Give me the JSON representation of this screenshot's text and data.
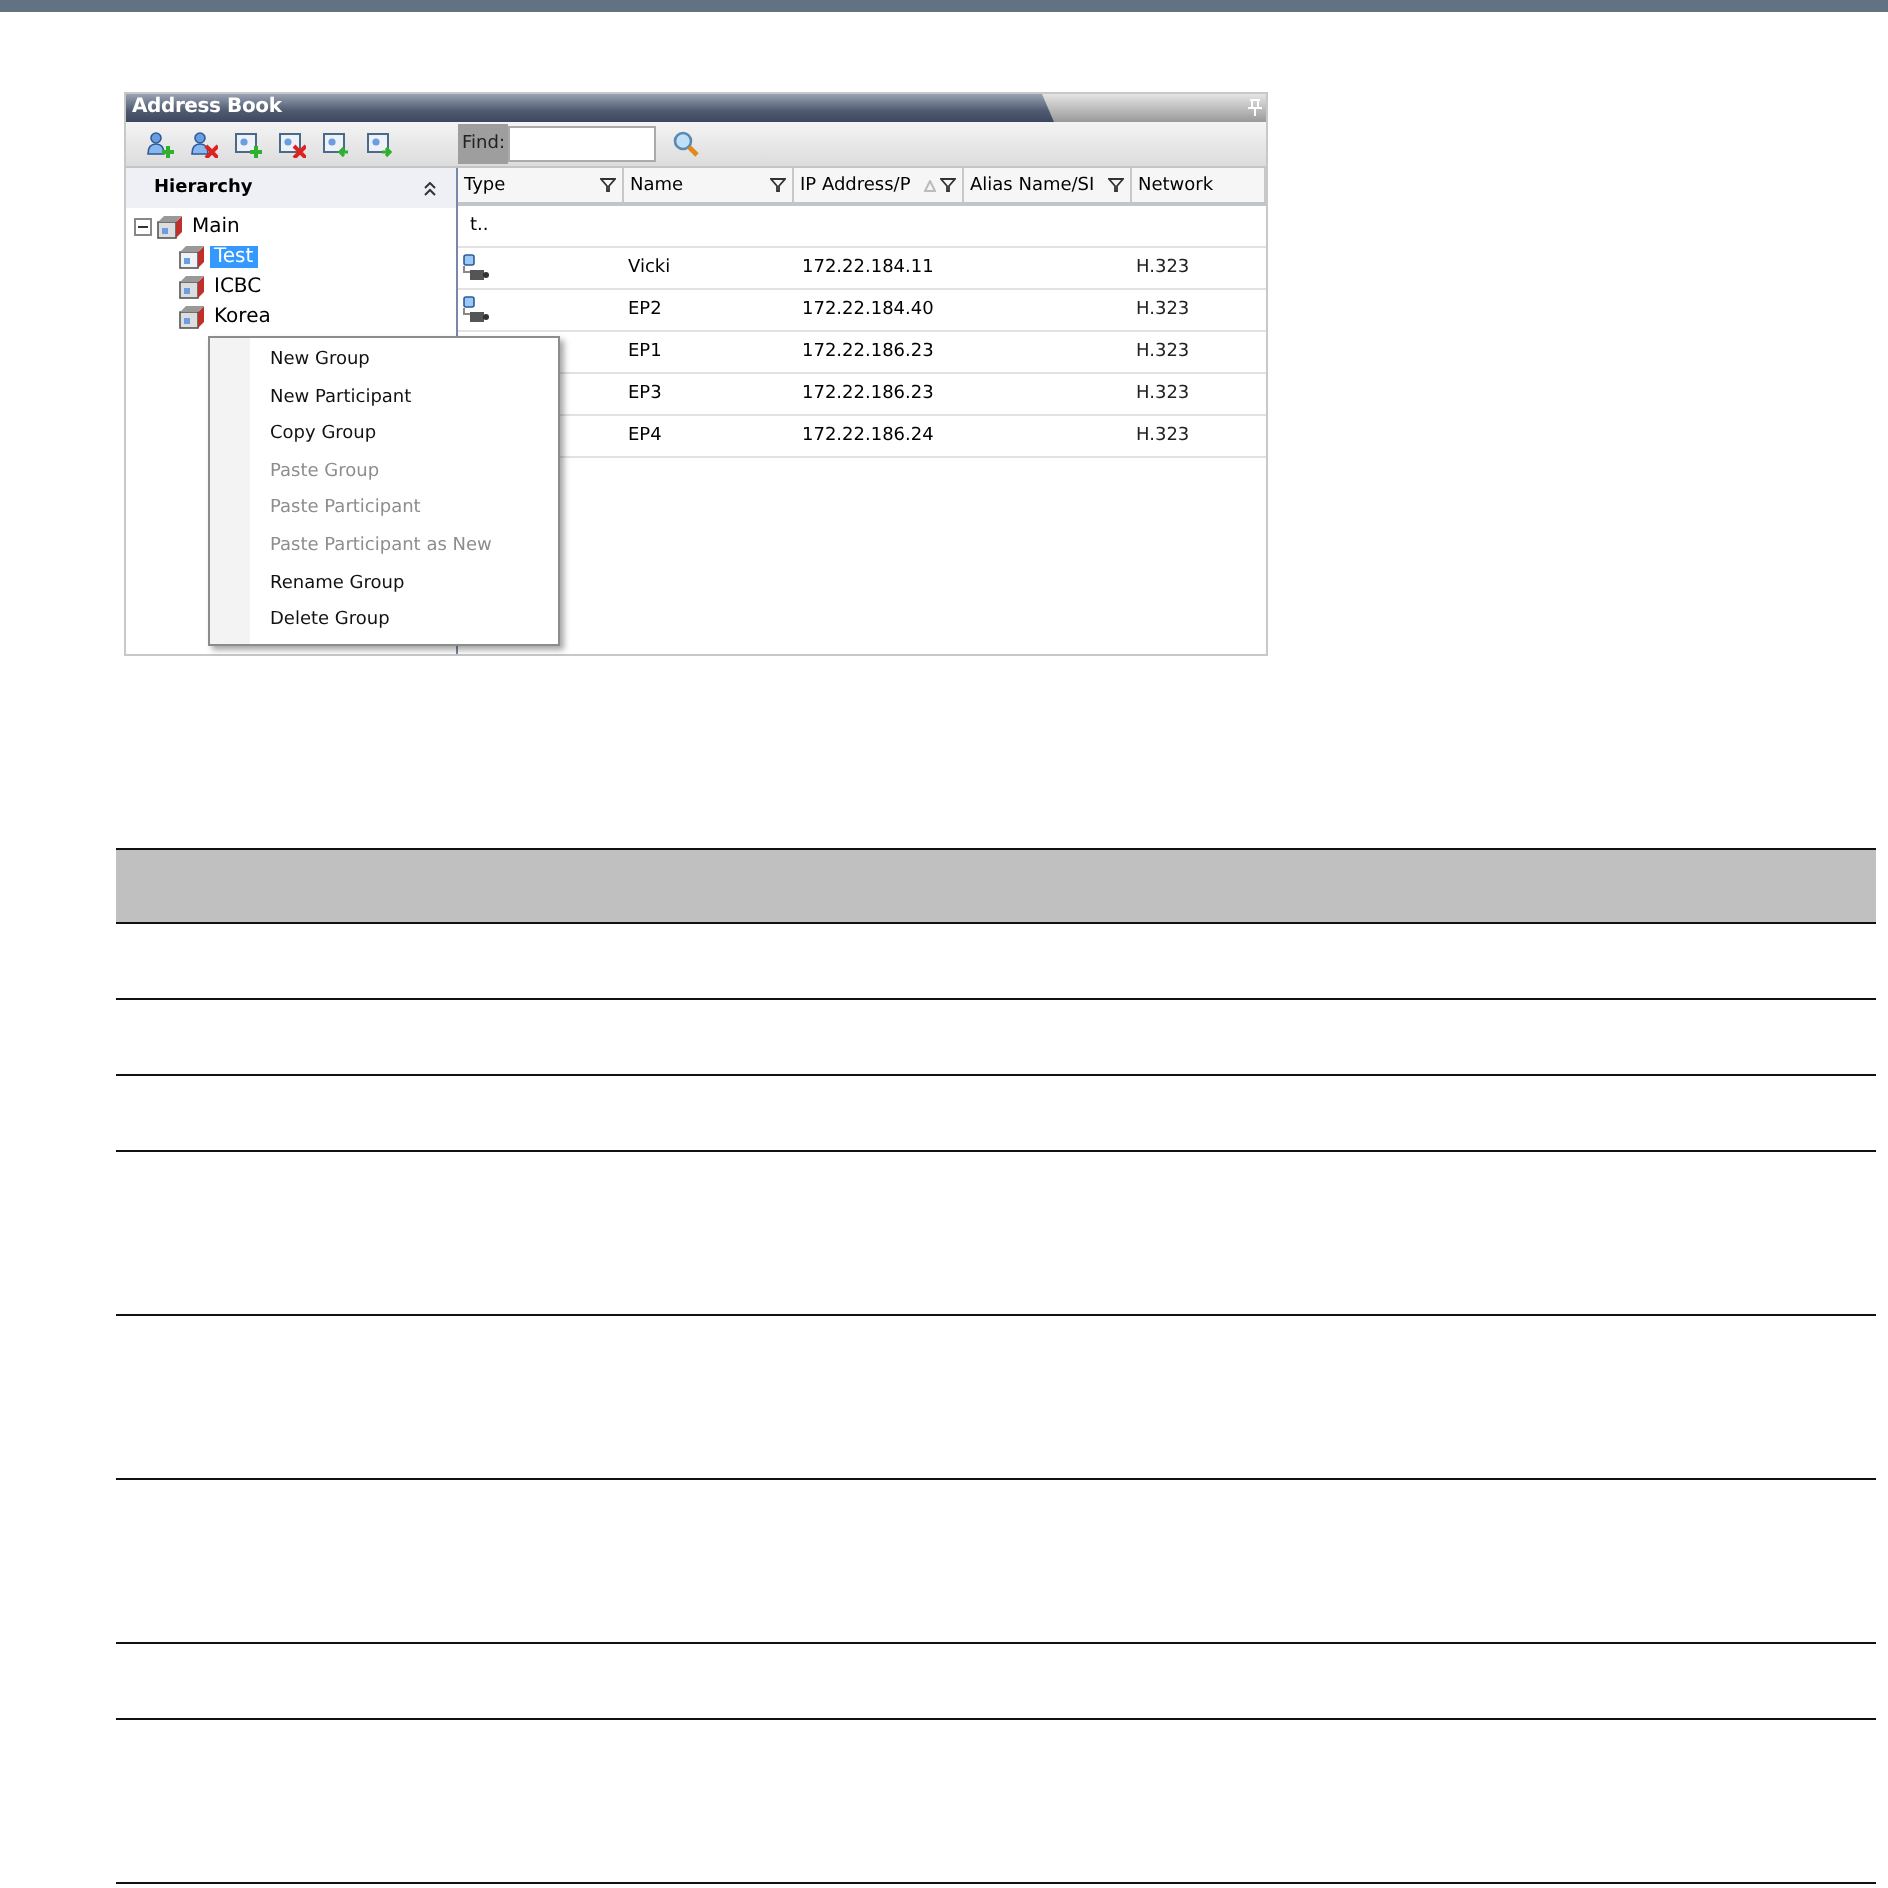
{
  "window": {
    "title": "Address Book"
  },
  "toolbar": {
    "find": {
      "label": "Find:"
    }
  },
  "hierarchy": {
    "title": "Hierarchy",
    "tree": [
      {
        "label": "Main",
        "expanded": true,
        "selected": false,
        "children": [
          {
            "label": "Test",
            "selected": true,
            "kind": "open"
          },
          {
            "label": "ICBC",
            "selected": false,
            "kind": "closed"
          },
          {
            "label": "Korea",
            "selected": false,
            "kind": "closed"
          }
        ]
      }
    ]
  },
  "table": {
    "columns": [
      {
        "label": "Type",
        "filter": true,
        "sorted": false
      },
      {
        "label": "Name",
        "filter": true,
        "sorted": false
      },
      {
        "label": "IP Address/P",
        "filter": true,
        "sorted": true
      },
      {
        "label": "Alias Name/SI",
        "filter": true,
        "sorted": false
      },
      {
        "label": "Network",
        "filter": false,
        "sorted": false
      }
    ],
    "up_row": "t..",
    "rows": [
      {
        "icon": true,
        "name": "Vicki",
        "ip": "172.22.184.11",
        "network": "H.323"
      },
      {
        "icon": true,
        "name": "EP2",
        "ip": "172.22.184.40",
        "network": "H.323"
      },
      {
        "name": "EP1",
        "ip": "172.22.186.23",
        "network": "H.323"
      },
      {
        "name": "EP3",
        "ip": "172.22.186.23",
        "network": "H.323"
      },
      {
        "name": "EP4",
        "ip": "172.22.186.24",
        "network": "H.323"
      }
    ]
  },
  "context_menu": [
    {
      "label": "New Group",
      "disabled": false
    },
    {
      "label": "New Participant",
      "disabled": false
    },
    {
      "label": "Copy Group",
      "disabled": false
    },
    {
      "label": "Paste Group",
      "disabled": true
    },
    {
      "label": "Paste Participant",
      "disabled": true
    },
    {
      "label": "Paste Participant as New",
      "disabled": true
    },
    {
      "label": "Rename Group",
      "disabled": false
    },
    {
      "label": "Delete Group",
      "disabled": false
    }
  ],
  "doc_table": {
    "rows": [
      {
        "kind": "short"
      },
      {
        "kind": "short"
      },
      {
        "kind": "short"
      },
      {
        "kind": "tall"
      },
      {
        "kind": "tall"
      },
      {
        "kind": "tall"
      },
      {
        "kind": "short"
      },
      {
        "kind": "tall"
      }
    ]
  }
}
